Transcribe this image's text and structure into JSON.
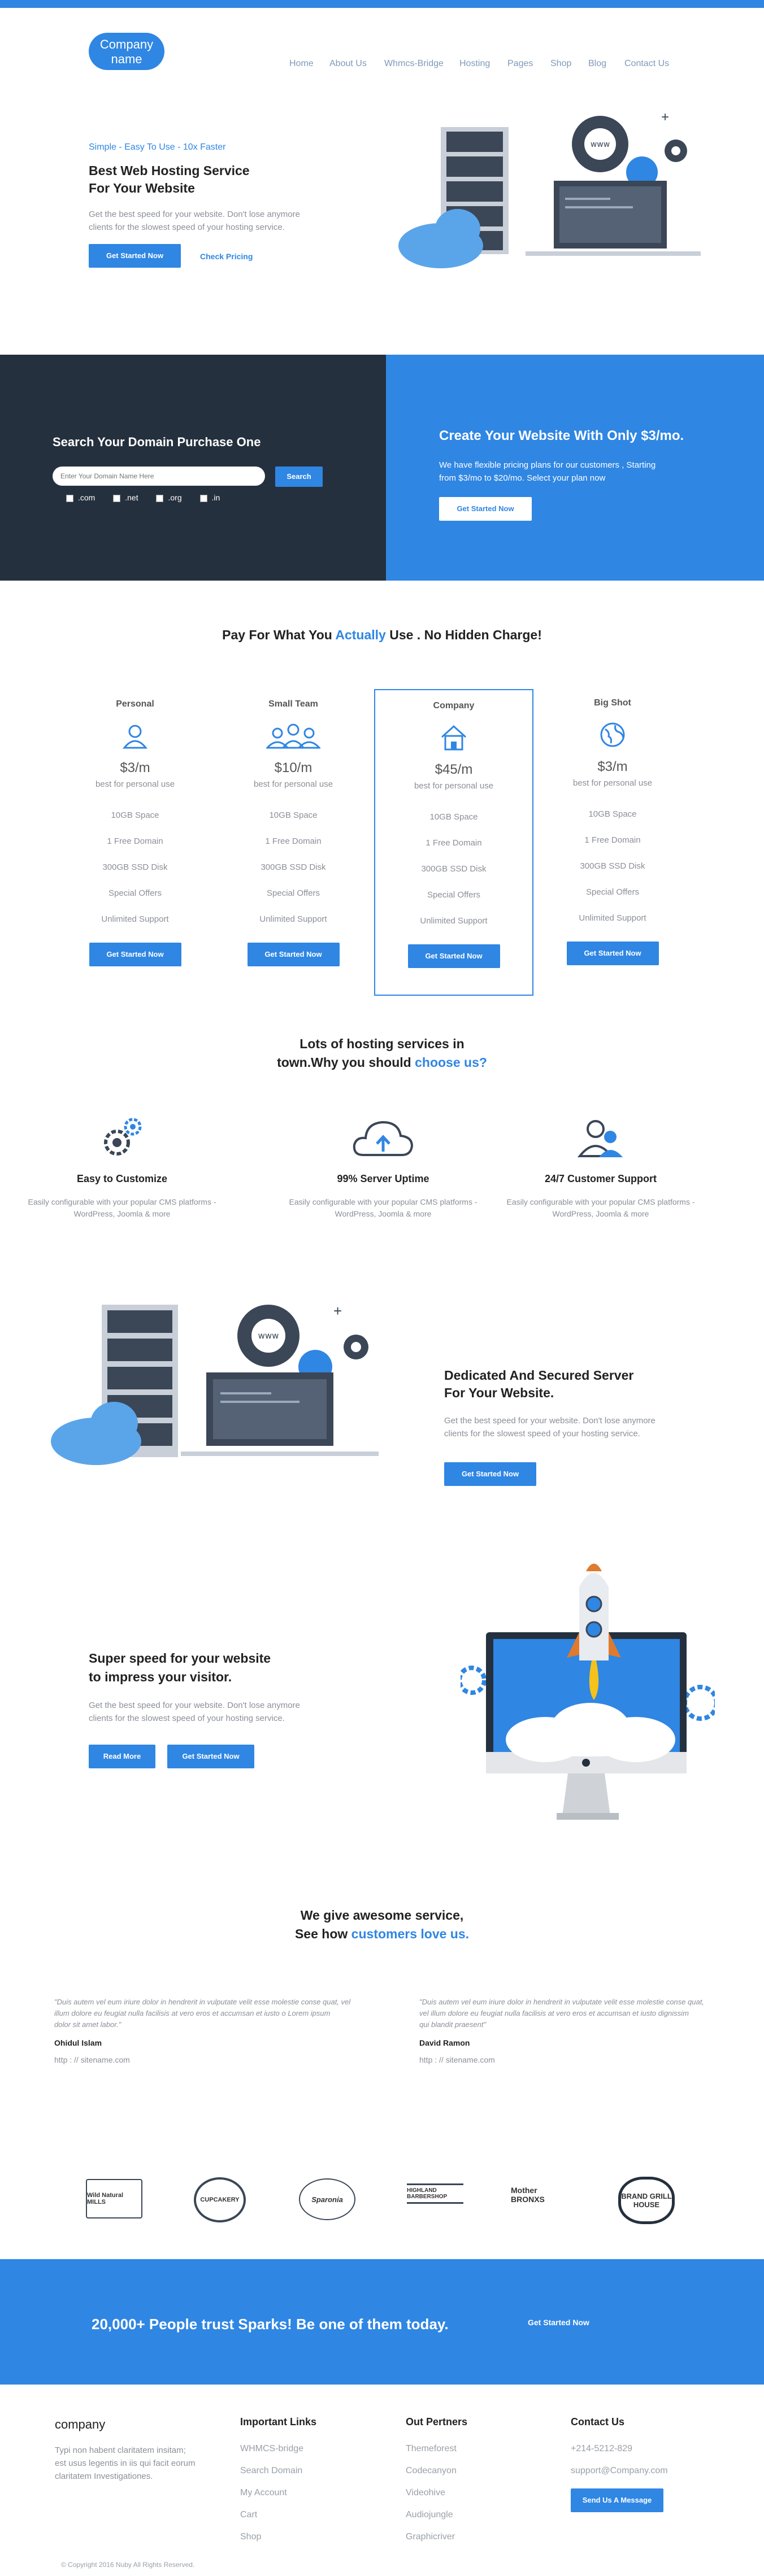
{
  "colors": {
    "primary": "#2f86e3",
    "dark": "#25303e"
  },
  "header": {
    "logo": "Company name",
    "nav": [
      "Home",
      "About Us",
      "Whmcs-Bridge",
      "Hosting",
      "Pages",
      "Shop",
      "Blog",
      "Contact Us"
    ]
  },
  "hero": {
    "tagline": "Simple - Easy To Use - 10x Faster",
    "title1": "Best Web Hosting Service",
    "title2": "For Your Website",
    "desc1": "Get the best speed for your website. Don't lose anymore",
    "desc2": "clients for the slowest speed of your hosting service.",
    "cta": "Get Started Now",
    "link": "Check Pricing"
  },
  "domain": {
    "title": "Search Your Domain Purchase One",
    "placeholder": "Enter Your Domain Name Here",
    "button": "Search",
    "tlds": [
      ".com",
      ".net",
      ".org",
      ".in"
    ]
  },
  "promo": {
    "title": "Create Your Website With Only $3/mo.",
    "desc1": "We have flexible pricing plans for our customers , Starting",
    "desc2": "from $3/mo to $20/mo. Select your plan now",
    "cta": "Get Started Now"
  },
  "pricing": {
    "title_a": "Pay For What You ",
    "title_b": "Actually",
    "title_c": " Use . No Hidden Charge!",
    "plans": [
      {
        "name": "Personal",
        "price": "$3/m",
        "sub": "best for personal use",
        "icon": "user-icon"
      },
      {
        "name": "Small Team",
        "price": "$10/m",
        "sub": "best for personal use",
        "icon": "team-icon"
      },
      {
        "name": "Company",
        "price": "$45/m",
        "sub": "best for personal use",
        "icon": "house-icon"
      },
      {
        "name": "Big Shot",
        "price": "$3/m",
        "sub": "best for personal use",
        "icon": "globe-icon"
      }
    ],
    "features": [
      "10GB Space",
      "1 Free Domain",
      "300GB SSD Disk",
      "Special Offers",
      "Unlimited Support"
    ],
    "cta": "Get Started Now"
  },
  "services": {
    "title1": "Lots of hosting services in",
    "title2a": "town.Why you should ",
    "title2b": "choose us?",
    "items": [
      {
        "title": "Easy to Customize",
        "d1": "Easily configurable with your popular CMS platforms -",
        "d2": "WordPress, Joomla & more"
      },
      {
        "title": "99% Server Uptime",
        "d1": "Easily configurable with your popular CMS platforms -",
        "d2": "WordPress, Joomla & more"
      },
      {
        "title": "24/7 Customer Support",
        "d1": "Easily configurable with your popular CMS platforms -",
        "d2": "WordPress, Joomla & more"
      }
    ]
  },
  "secure": {
    "title1": "Dedicated And Secured Server",
    "title2": "For Your Website.",
    "desc1": "Get the best speed for your website. Don't lose anymore",
    "desc2": "clients for the slowest speed of your hosting service.",
    "cta": "Get Started Now"
  },
  "speed": {
    "title1": "Super speed for your website",
    "title2": "to impress your visitor.",
    "desc1": "Get the best speed for your website. Don't lose anymore",
    "desc2": "clients for the slowest speed of your hosting service.",
    "read": "Read More",
    "cta": "Get Started Now"
  },
  "testimonials": {
    "title1": "We give awesome service,",
    "title2a": "See how ",
    "title2b": "customers love us.",
    "items": [
      {
        "q1": "\"Duis autem vel eum iriure dolor in hendrerit in vulputate velit esse molestie conse quat, vel",
        "q2": "illum dolore eu feugiat nulla facilisis at vero eros et accumsan et iusto o Lorem ipsum",
        "q3": "dolor sit amet labor.\"",
        "name": "Ohidul Islam",
        "site": "http : // sitename.com"
      },
      {
        "q1": "\"Duis autem vel eum iriure dolor in hendrerit in vulputate velit esse molestie conse quat,",
        "q2": "vel illum dolore eu feugiat nulla facilisis at vero eros et accumsan et iusto dignissim",
        "q3": "qui blandit praesent\"",
        "name": "David Ramon",
        "site": "http : // sitename.com"
      }
    ]
  },
  "brands": [
    "Wild Natural MILLS",
    "CUPCAKERY",
    "Sparonia",
    "HIGHLAND BARBERSHOP",
    "Mother BRONXS",
    "BRAND GRILL HOUSE"
  ],
  "trust": {
    "text": "20,000+ People trust Sparks! Be one of them today.",
    "cta": "Get Started Now"
  },
  "footer": {
    "brand": "company",
    "about1": "Typi non habent claritatem insitam;",
    "about2": "est usus legentis in iis qui facit eorum",
    "about3": "claritatem Investigationes.",
    "links_title": "Important Links",
    "links": [
      "WHMCS-bridge",
      "Search Domain",
      "My Account",
      "Cart",
      "Shop"
    ],
    "partners_title": "Out Pertners",
    "partners": [
      "Themeforest",
      "Codecanyon",
      "Videohive",
      "Audiojungle",
      "Graphicriver"
    ],
    "contact_title": "Contact Us",
    "phone": "+214-5212-829",
    "email": "support@Company.com",
    "contact_btn": "Send Us A Message",
    "copyright": "© Copyright 2016 Nuby All Rights Reserved."
  }
}
